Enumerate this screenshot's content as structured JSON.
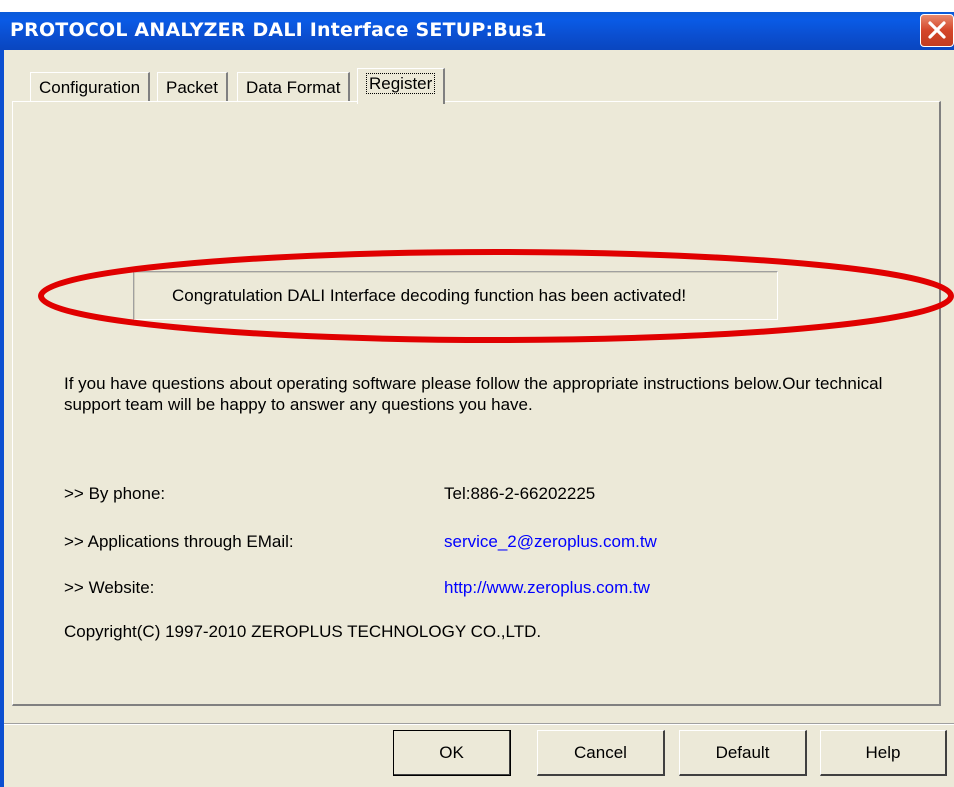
{
  "window": {
    "title": "PROTOCOL ANALYZER DALI Interface SETUP:Bus1",
    "close_glyph": "close-icon"
  },
  "tabs": [
    {
      "label": "Configuration",
      "active": false
    },
    {
      "label": "Packet",
      "active": false
    },
    {
      "label": "Data Format",
      "active": false
    },
    {
      "label": "Register",
      "active": true
    }
  ],
  "register": {
    "activation_message": "Congratulation DALI Interface decoding function has been activated!",
    "intro": "If you have questions about operating software please follow the appropriate instructions below.Our technical support team will be happy to answer any questions you have.",
    "contacts": [
      {
        "label": ">> By phone:",
        "value": "Tel:886-2-66202225",
        "link": false
      },
      {
        "label": ">> Applications through EMail:",
        "value": "service_2@zeroplus.com.tw",
        "link": true
      },
      {
        "label": ">> Website:",
        "value": "http://www.zeroplus.com.tw",
        "link": true
      }
    ],
    "copyright": "Copyright(C) 1997-2010 ZEROPLUS TECHNOLOGY CO.,LTD."
  },
  "buttons": {
    "ok": "OK",
    "cancel": "Cancel",
    "default": "Default",
    "help": "Help"
  },
  "colors": {
    "titlebar": "#0b4fd1",
    "dialog_bg": "#ECE9D8",
    "link": "#0000ff",
    "highlight_ellipse": "#e00000"
  }
}
